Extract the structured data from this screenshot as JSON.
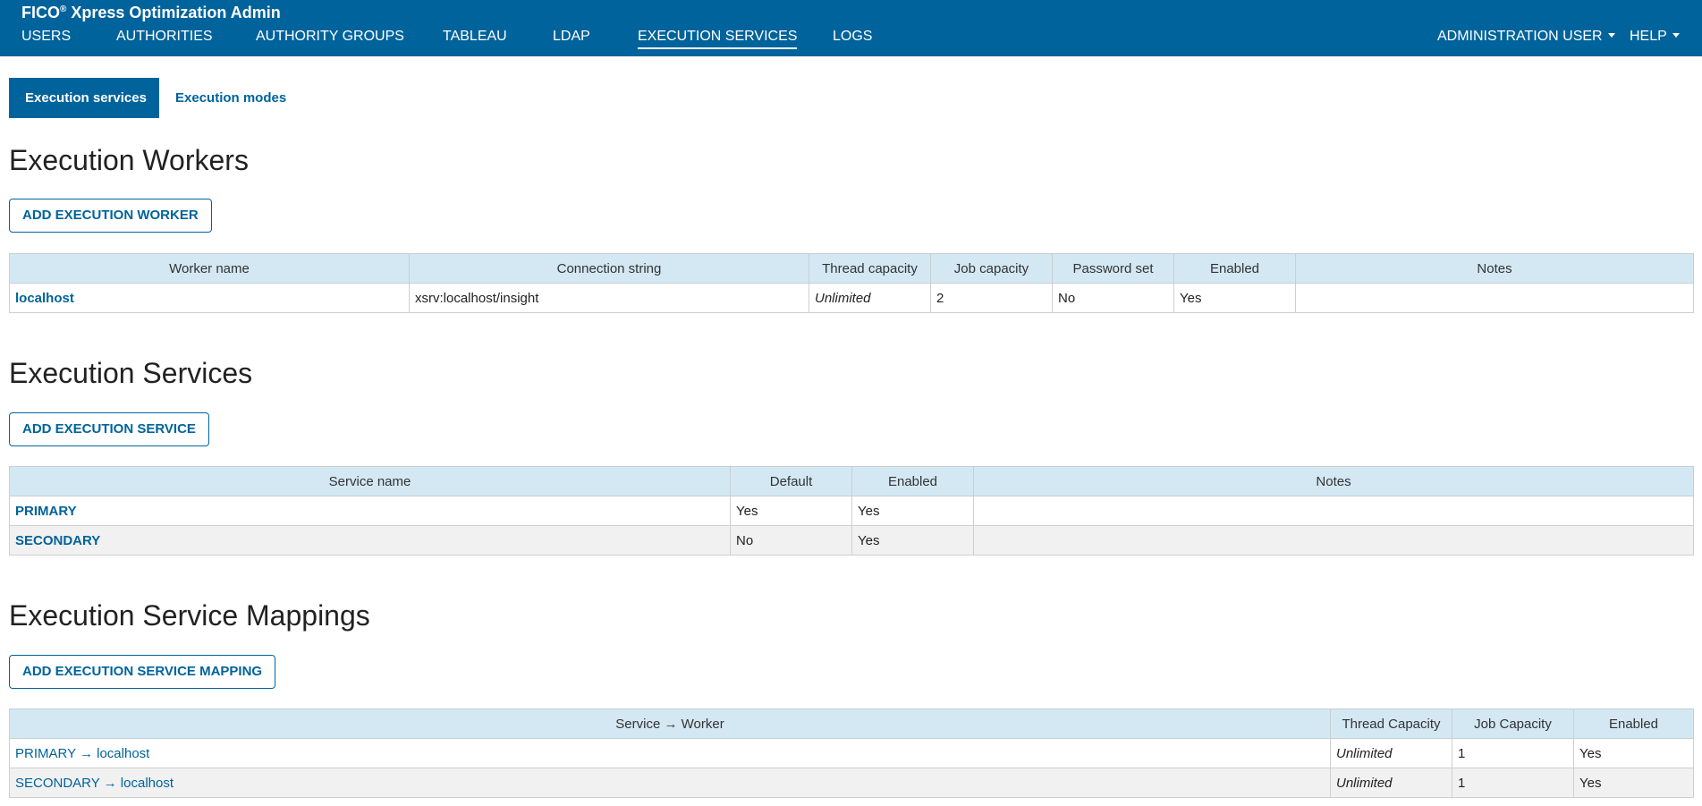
{
  "header": {
    "app_title": "FICO",
    "app_title_sup": "®",
    "app_title_rest": " Xpress Optimization Admin",
    "nav": [
      {
        "label": "USERS",
        "active": false
      },
      {
        "label": "AUTHORITIES",
        "active": false
      },
      {
        "label": "AUTHORITY GROUPS",
        "active": false
      },
      {
        "label": "TABLEAU",
        "active": false
      },
      {
        "label": "LDAP",
        "active": false
      },
      {
        "label": "EXECUTION SERVICES",
        "active": true
      },
      {
        "label": "LOGS",
        "active": false
      }
    ],
    "user_menu": "ADMINISTRATION USER",
    "help_menu": "HELP",
    "brand_color": "#00639b"
  },
  "subtabs": [
    {
      "label": "Execution services",
      "active": true
    },
    {
      "label": "Execution modes",
      "active": false
    }
  ],
  "workers": {
    "title": "Execution Workers",
    "add_button": "ADD EXECUTION WORKER",
    "columns": [
      "Worker name",
      "Connection string",
      "Thread capacity",
      "Job capacity",
      "Password set",
      "Enabled",
      "Notes"
    ],
    "rows": [
      {
        "name": "localhost",
        "connection": "xsrv:localhost/insight",
        "thread_capacity": "Unlimited",
        "job_capacity": "2",
        "password_set": "No",
        "enabled": "Yes",
        "notes": ""
      }
    ]
  },
  "services": {
    "title": "Execution Services",
    "add_button": "ADD EXECUTION SERVICE",
    "columns": [
      "Service name",
      "Default",
      "Enabled",
      "Notes"
    ],
    "rows": [
      {
        "name": "PRIMARY",
        "default": "Yes",
        "enabled": "Yes",
        "notes": ""
      },
      {
        "name": "SECONDARY",
        "default": "No",
        "enabled": "Yes",
        "notes": ""
      }
    ]
  },
  "mappings": {
    "title": "Execution Service Mappings",
    "add_button": "ADD EXECUTION SERVICE MAPPING",
    "columns": [
      "Service → Worker",
      "Thread Capacity",
      "Job Capacity",
      "Enabled"
    ],
    "rows": [
      {
        "mapping": "PRIMARY → localhost",
        "thread_capacity": "Unlimited",
        "job_capacity": "1",
        "enabled": "Yes"
      },
      {
        "mapping": "SECONDARY → localhost",
        "thread_capacity": "Unlimited",
        "job_capacity": "1",
        "enabled": "Yes"
      }
    ]
  }
}
